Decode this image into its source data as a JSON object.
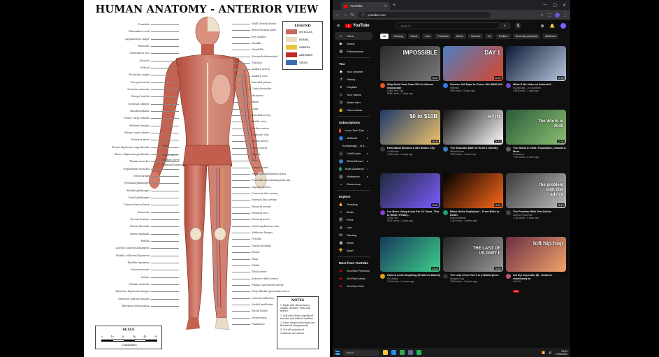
{
  "poster": {
    "title": "HUMAN ANATOMY - ANTERIOR VIEW",
    "left_labels": [
      "Frontalis",
      "Orbicularis oculi",
      "Zygomaticus major",
      "Masseter",
      "Orbicularis oris",
      "Clavicle",
      "Deltoid",
      "Pectoralis major",
      "Triceps brachii",
      "Serratus anterior",
      "Biceps brachii",
      "External oblique",
      "Brachioradialis",
      "Flexor carpi radialis",
      "Palmaris longus",
      "Flexor carpi ulnaris",
      "Pronator teres",
      "Flexor digitorum superficialis",
      "Flexor digitorum profundus",
      "Thenar muscles",
      "Hypothenar muscles",
      "Metacarpals",
      "Proximal phalanges",
      "Middle phalanges",
      "Distal phalanges",
      "Tensor fasciae latae",
      "Sartorius",
      "Rectus femoris",
      "Vastus lateralis",
      "Vastus medialis",
      "Patella",
      "Lateral collateral ligament",
      "Medial collateral ligament",
      "Patellar ligament",
      "Gastrocnemius",
      "Soleus",
      "Tibialis anterior",
      "Extensor digitorum longus",
      "Extensor hallucis longus",
      "Extensor retinaculum"
    ],
    "center_labels": [
      "Ulna",
      "Ulnar nerve",
      "Median nerve",
      "Inguinal ligament"
    ],
    "right_labels": [
      "Skull (frontal bone)",
      "Brain (frontal lobe)",
      "Eye (globe)",
      "Maxilla",
      "Mandible",
      "Sternocleidomastoid",
      "Trachea",
      "Axillary artery",
      "Axillary vein",
      "Brachial plexus",
      "Costoclavicular",
      "Humerus",
      "Heart",
      "Lung",
      "Brachial artery",
      "Basilic vein",
      "Median nerve",
      "Cephalic vein",
      "Radial artery",
      "Ulnar artery",
      "Radius",
      "Ulna",
      "Carpal bones",
      "Metacarpophalangeal joint",
      "Proximal interphalangeal joint",
      "Digital arteries",
      "Common iliac artery",
      "Internal iliac artery",
      "Femoral artery",
      "Femoral vein",
      "Femoral nerve",
      "Great saphenous vein",
      "Adductor longus",
      "Gracilis",
      "Vastus medialis",
      "Femur",
      "Tibia",
      "Fibula",
      "Tibial nerve",
      "Anterior tibial artery",
      "Fibular (peroneal) artery",
      "Deep fibular (peroneal) nerve",
      "Lateral malleolus",
      "Medial malleolus",
      "Tarsal bones",
      "Metatarsals",
      "Phalanges"
    ],
    "legend": {
      "title": "LEGEND",
      "items": [
        {
          "label": "MUSCLES",
          "color": "#c9695a"
        },
        {
          "label": "BONES",
          "color": "#ecdcc4"
        },
        {
          "label": "NERVES",
          "color": "#e9c33c"
        },
        {
          "label": "ARTERIES",
          "color": "#c22b2b"
        },
        {
          "label": "VEINS",
          "color": "#3b6fb5"
        }
      ]
    },
    "notes": {
      "title": "NOTES",
      "items": [
        "1. Right side shows bones, organs, arteries, veins and nerves.",
        "2. Left side shows superficial muscles and related tendons.",
        "3. Some deeper structures are illustrated transparently.",
        "4. Not all anatomical variations are shown."
      ]
    },
    "scale": {
      "title": "SCALE",
      "ticks": [
        "0",
        "10",
        "20",
        "30",
        "40",
        "50"
      ],
      "unit": "Centimeters"
    }
  },
  "browser": {
    "tab_title": "YouTube",
    "url": "youtube.com",
    "search_placeholder": "Search",
    "logo_text": "YouTube"
  },
  "sidebar": {
    "main": [
      "Home",
      "Shorts",
      "Subscriptions"
    ],
    "you_title": "You",
    "you": [
      "Your channel",
      "History",
      "Playlists",
      "Your videos",
      "Watch later",
      "Liked videos"
    ],
    "subs_title": "Subscriptions",
    "subs": [
      {
        "name": "Linus Tech Tips",
        "color": "#e35b1e"
      },
      {
        "name": "MrBeast",
        "color": "#2d7be0"
      },
      {
        "name": "Kurzgesagt – In a...",
        "color": "#6e4bd8"
      },
      {
        "name": "ColdFusion",
        "color": "#3a3a3a"
      },
      {
        "name": "3Blue1Brown",
        "color": "#3a7bbf"
      },
      {
        "name": "Khan Academy",
        "color": "#1f9e73"
      },
      {
        "name": "Veritasium",
        "color": "#5c5c5c"
      }
    ],
    "show_more": "Show more",
    "explore_title": "Explore",
    "explore": [
      "Trending",
      "Music",
      "Films",
      "Live",
      "Gaming",
      "News",
      "Sport"
    ],
    "more_title": "More from YouTube",
    "more": [
      "YouTube Premium",
      "YouTube Music",
      "YouTube Kids"
    ]
  },
  "chips": [
    "All",
    "Gaming",
    "Music",
    "Live",
    "Podcasts",
    "Mixes",
    "Science",
    "AI",
    "Thrillers",
    "Recently uploaded",
    "Watched"
  ],
  "videos": [
    {
      "title": "Why Build Your Own GPU is Almost Impossible",
      "channel": "Linus Tech Tips",
      "stats": "849K views • 2 days ago",
      "duration": "15:20",
      "thumb_text": "IMPOSSIBLE",
      "bg": "#2b2b2b",
      "accent": "#7a7a7a",
      "av": "#e35b1e"
    },
    {
      "title": "Survive 100 Days In Circle, Win $500,000",
      "channel": "MrBeast",
      "stats": "95M views • 3 days ago",
      "duration": "32:00",
      "thumb_text": "DAY 1",
      "bg": "#4e7fc0",
      "accent": "#d9452b",
      "av": "#2d7be0"
    },
    {
      "title": "What If We Nuke an Asteroid?",
      "channel": "Kurzgesagt – In a Nutshell",
      "stats": "4.8M views • 2 days ago",
      "duration": "10:06",
      "thumb_text": "",
      "bg": "#0c1a35",
      "accent": "#b9c7e0",
      "av": "#6e4bd8"
    },
    {
      "title": "How Babel Became a $10 Billion City",
      "channel": "ColdFusion",
      "stats": "1.8M views • 5 days ago",
      "duration": "18:45",
      "thumb_text": "$0 to $10B",
      "bg": "#1e3a6a",
      "accent": "#f0c36b",
      "av": "#3a3a3a"
    },
    {
      "title": "The Beautiful Math of Euler's Identity",
      "channel": "3Blue1Brown",
      "stats": "2.8M views • 1 week ago",
      "duration": "21:14",
      "thumb_text": "e^iπ",
      "bg": "#111111",
      "accent": "#ffffff",
      "av": "#3a7bbf"
    },
    {
      "title": "The World in 2040: Population, Climate & More",
      "channel": "Veritasium",
      "stats": "7.9M views • 1 week ago",
      "duration": "12:34",
      "thumb_text": "The World in 2040",
      "bg": "#2a5a3a",
      "accent": "#8ac070",
      "av": "#5c5c5c"
    },
    {
      "title": "I've Been Using Linux For 12 Years. This Is What I Finally...",
      "channel": "Chris Titus",
      "stats": "520K views • 3 days ago",
      "duration": "19:03",
      "thumb_text": "",
      "bg": "#1f2a3a",
      "accent": "#7c5cff",
      "av": "#8b3fd1"
    },
    {
      "title": "Black Holes Explained – From Birth to Death",
      "channel": "Khan Academy",
      "stats": "1.4M views • 2 weeks ago",
      "duration": "15:44",
      "thumb_text": "",
      "bg": "#000000",
      "accent": "#ff6a1a",
      "av": "#1f9e73"
    },
    {
      "title": "The Problem With Diet Advice",
      "channel": "Andrew Huberman",
      "stats": "2.4M views • 4 days ago",
      "duration": "18:12",
      "thumb_text": "the problem with diet advice",
      "bg": "#3a3a3a",
      "accent": "#bbbbbb",
      "av": "#444444"
    },
    {
      "title": "How to Learn Anything (Evidence Based)",
      "channel": "Ali Abdaal",
      "stats": "2.1M views • 2 weeks ago",
      "duration": "14:28",
      "thumb_text": "",
      "bg": "#173a5a",
      "accent": "#3ecf8e",
      "av": "#e0a020"
    },
    {
      "title": "The Last of Us Part 2 is a Masterpiece",
      "channel": "Naughty Dog",
      "stats": "3.6M views • 3 weeks ago",
      "duration": "26:50",
      "thumb_text": "THE LAST OF US PART II",
      "bg": "#222222",
      "accent": "#999999",
      "av": "#333333"
    },
    {
      "title": "lofi hip hop radio 📚 - beats to relax/study to",
      "channel": "Lofi Girl",
      "stats": "LIVE",
      "duration": "",
      "thumb_text": "lofi hip hop",
      "bg": "#6b2f45",
      "accent": "#f3a36b",
      "av": "#c05080"
    }
  ],
  "taskbar": {
    "search": "Search",
    "time": "09:24",
    "date": "17/04/2024"
  }
}
